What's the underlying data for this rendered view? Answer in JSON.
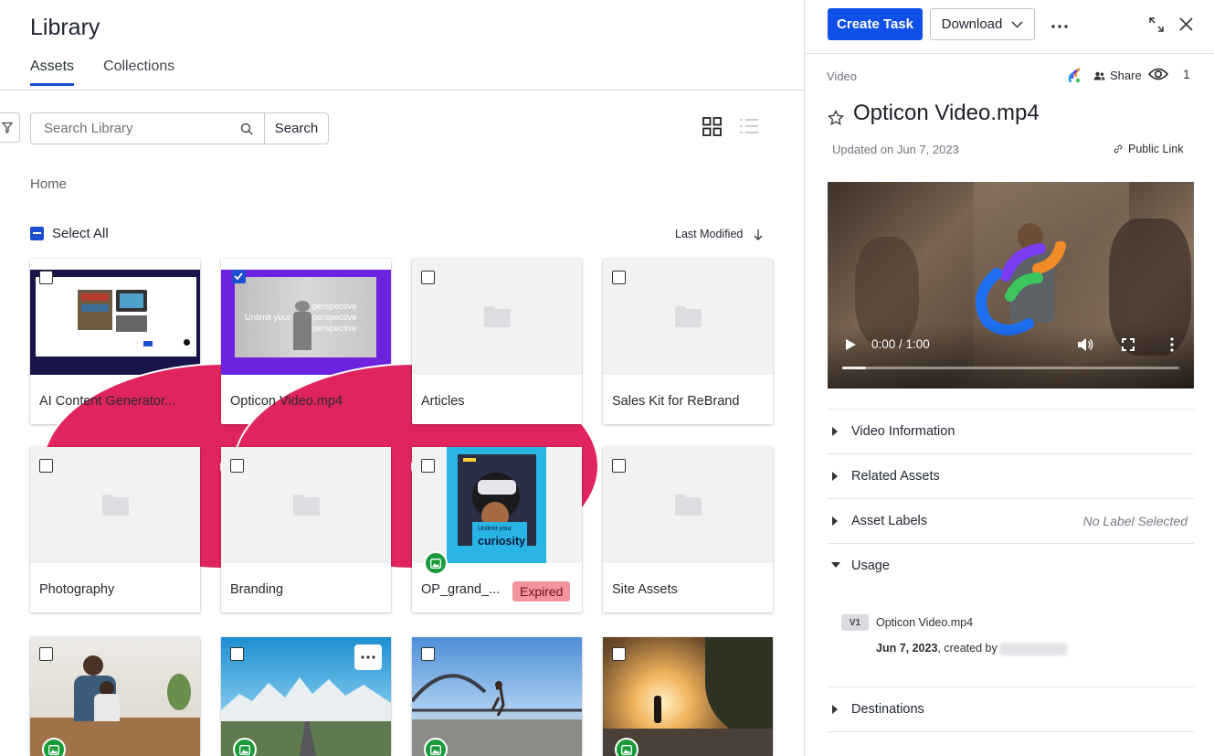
{
  "library": {
    "title": "Library",
    "tabs": [
      {
        "label": "Assets",
        "active": true
      },
      {
        "label": "Collections",
        "active": false
      }
    ],
    "search": {
      "placeholder": "Search Library",
      "button_label": "Search"
    },
    "breadcrumb": "Home",
    "select_all_label": "Select All",
    "sort_label": "Last Modified",
    "cards": [
      {
        "label": "AI Content Generator...",
        "kind": "video",
        "checked": false
      },
      {
        "label": "Opticon Video.mp4",
        "kind": "video",
        "checked": true
      },
      {
        "label": "Articles",
        "kind": "folder",
        "checked": false
      },
      {
        "label": "Sales Kit for ReBrand",
        "kind": "folder",
        "checked": false
      },
      {
        "label": "Photography",
        "kind": "folder",
        "checked": false
      },
      {
        "label": "Branding",
        "kind": "folder",
        "checked": false
      },
      {
        "label": "OP_grand_...",
        "kind": "image",
        "checked": false,
        "status": "Expired"
      },
      {
        "label": "Site Assets",
        "kind": "folder",
        "checked": false
      },
      {
        "label": "",
        "kind": "image",
        "checked": false
      },
      {
        "label": "",
        "kind": "image",
        "checked": false
      },
      {
        "label": "",
        "kind": "image",
        "checked": false
      },
      {
        "label": "",
        "kind": "image",
        "checked": false
      }
    ],
    "thumb_texts": {
      "unlimit_your": "Unlimit your",
      "perspective_1": "perspective",
      "perspective_2": "perspective",
      "perspective_3": "perspective",
      "curiosity_small": "Unlimit your",
      "curiosity": "curiosity"
    }
  },
  "detail": {
    "create_task_label": "Create Task",
    "download_label": "Download",
    "asset_type": "Video",
    "share_label": "Share",
    "view_count": "1",
    "asset_title": "Opticon Video.mp4",
    "updated": "Updated on Jun 7, 2023",
    "public_link_label": "Public Link",
    "video": {
      "time": "0:00 / 1:00",
      "progress": 0.0
    },
    "sections": [
      {
        "label": "Video Information",
        "expanded": false
      },
      {
        "label": "Related Assets",
        "expanded": false
      },
      {
        "label": "Asset Labels",
        "expanded": false,
        "aside": "No Label Selected"
      },
      {
        "label": "Usage",
        "expanded": true
      },
      {
        "label": "Destinations",
        "expanded": false
      }
    ],
    "usage": {
      "version_badge": "V1",
      "file_name": "Opticon Video.mp4",
      "date": "Jun 7, 2023",
      "created_by_text": ", created by"
    }
  },
  "colors": {
    "primary": "#0f50e8",
    "video_badge": "#e0245e",
    "image_badge": "#1a9b3a",
    "expired_bg": "#f3959f"
  }
}
